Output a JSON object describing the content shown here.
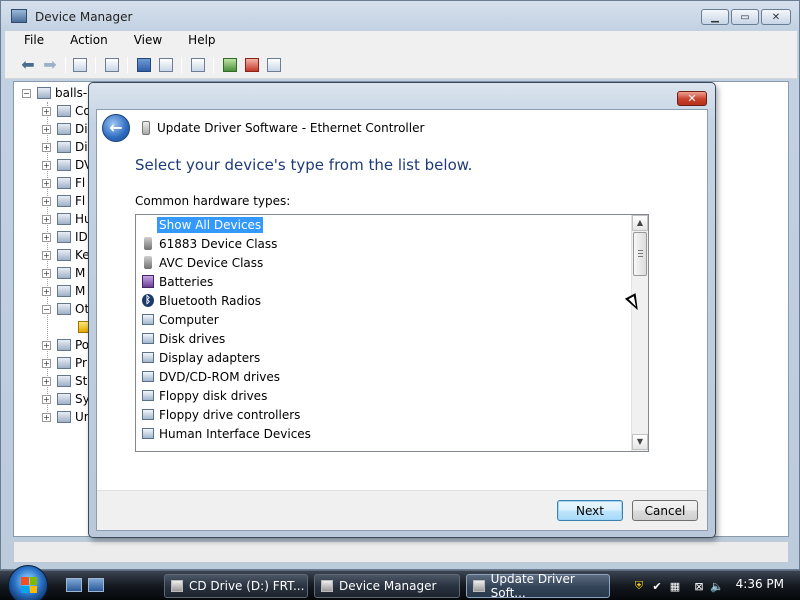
{
  "window": {
    "title": "Device Manager",
    "menu": [
      "File",
      "Action",
      "View",
      "Help"
    ]
  },
  "tree": {
    "root": "balls-",
    "items": [
      "Co",
      "Di",
      "Di",
      "DV",
      "Fl",
      "Fl",
      "Hu",
      "ID",
      "Ke",
      "M",
      "M",
      "Ot",
      "",
      "Po",
      "Pr",
      "St",
      "Sy",
      "Ur"
    ]
  },
  "dialog": {
    "title": "Update Driver Software - Ethernet Controller",
    "heading": "Select your device's type from the list below.",
    "list_caption": "Common hardware types:",
    "items": [
      {
        "label": "Show All Devices",
        "icon": "none",
        "selected": true
      },
      {
        "label": "61883 Device Class",
        "icon": "usb-icon"
      },
      {
        "label": "AVC Device Class",
        "icon": "usb-icon"
      },
      {
        "label": "Batteries",
        "icon": "battery-icon"
      },
      {
        "label": "Bluetooth Radios",
        "icon": "bluetooth-icon"
      },
      {
        "label": "Computer",
        "icon": "computer-icon"
      },
      {
        "label": "Disk drives",
        "icon": "disk-drive-icon"
      },
      {
        "label": "Display adapters",
        "icon": "display-adapter-icon"
      },
      {
        "label": "DVD/CD-ROM drives",
        "icon": "dvd-drive-icon"
      },
      {
        "label": "Floppy disk drives",
        "icon": "floppy-drive-icon"
      },
      {
        "label": "Floppy drive controllers",
        "icon": "floppy-controller-icon"
      },
      {
        "label": "Human Interface Devices",
        "icon": "hid-icon"
      }
    ],
    "next_label": "Next",
    "cancel_label": "Cancel",
    "close_glyph": "✕"
  },
  "taskbar": {
    "tasks": [
      {
        "label": "CD Drive (D:) FRT...",
        "active": false
      },
      {
        "label": "Device Manager",
        "active": false
      },
      {
        "label": "Update Driver Soft...",
        "active": true
      }
    ],
    "clock": "4:36 PM"
  },
  "colors": {
    "heading_blue": "#1f3b78",
    "selection": "#3399ff"
  }
}
